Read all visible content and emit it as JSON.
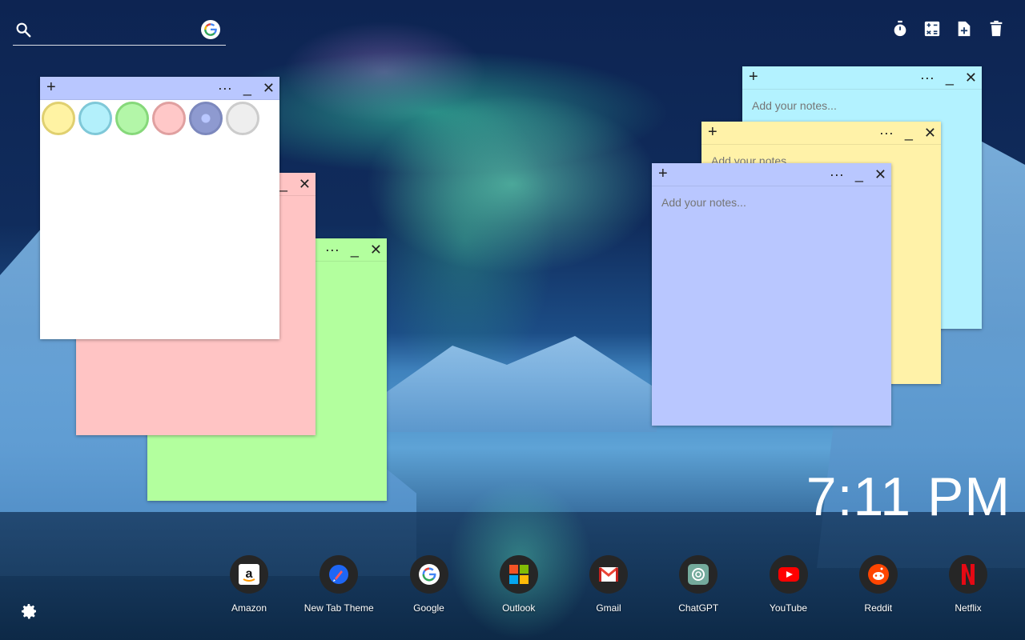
{
  "search": {
    "placeholder": "",
    "value": ""
  },
  "toolbar": {
    "icons": [
      "stopwatch-icon",
      "calculator-icon",
      "add-note-icon",
      "trash-icon"
    ]
  },
  "notes": [
    {
      "id": "blue",
      "color": "#b9c7ff",
      "placeholder": "Add your notes..."
    },
    {
      "id": "yellow",
      "color": "#fff2a8",
      "placeholder": "Add your notes..."
    },
    {
      "id": "cyan",
      "color": "#b3f2ff",
      "placeholder": "Add your notes..."
    },
    {
      "id": "white",
      "color": "#ffffff",
      "placeholder": ""
    },
    {
      "id": "pink",
      "color": "#ffc4c4",
      "placeholder": ""
    },
    {
      "id": "green",
      "color": "#b3ff9e",
      "placeholder": ""
    }
  ],
  "note_controls": {
    "plus": "+",
    "more": "···",
    "minimize": "_",
    "close": "✕"
  },
  "color_picker": {
    "swatches": [
      "#fff3a3",
      "#b3f0fb",
      "#b3f6a8",
      "#ffc8c8",
      "#9aa6d6",
      "#eeeeee"
    ],
    "selected": 4
  },
  "clock": {
    "time": "7:11 PM"
  },
  "shortcuts": [
    {
      "label": "Amazon",
      "icon": "amazon-icon"
    },
    {
      "label": "New Tab Theme",
      "icon": "new-tab-theme-icon"
    },
    {
      "label": "Google",
      "icon": "google-icon"
    },
    {
      "label": "Outlook",
      "icon": "outlook-icon"
    },
    {
      "label": "Gmail",
      "icon": "gmail-icon"
    },
    {
      "label": "ChatGPT",
      "icon": "chatgpt-icon"
    },
    {
      "label": "YouTube",
      "icon": "youtube-icon"
    },
    {
      "label": "Reddit",
      "icon": "reddit-icon"
    },
    {
      "label": "Netflix",
      "icon": "netflix-icon"
    }
  ]
}
